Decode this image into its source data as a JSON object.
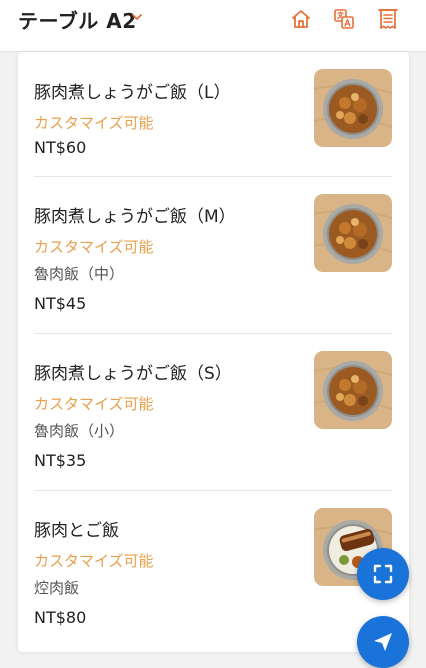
{
  "header": {
    "title": "テーブル A2",
    "icons": [
      "home-icon",
      "translate-icon",
      "receipt-icon"
    ],
    "accent_color": "#e8703a"
  },
  "menu": {
    "items": [
      {
        "name": "豚肉煮しょうがご飯（L）",
        "custom": "カスタマイズ可能",
        "desc": "",
        "price": "NT$60",
        "image": "braised-pork-rice-dish"
      },
      {
        "name": "豚肉煮しょうがご飯（M）",
        "custom": "カスタマイズ可能",
        "desc": "魯肉飯（中）",
        "price": "NT$45",
        "image": "braised-pork-rice-dish"
      },
      {
        "name": "豚肉煮しょうがご飯（S）",
        "custom": "カスタマイズ可能",
        "desc": "魯肉飯（小）",
        "price": "NT$35",
        "image": "braised-pork-rice-dish"
      },
      {
        "name": "豚肉とご飯",
        "custom": "カスタマイズ可能",
        "desc": "焢肉飯",
        "price": "NT$80",
        "image": "pork-belly-rice-dish"
      }
    ],
    "custom_color": "#e8a04d"
  },
  "fabs": {
    "scan": "scan-icon",
    "send": "send-icon",
    "color": "#1a73d9"
  }
}
